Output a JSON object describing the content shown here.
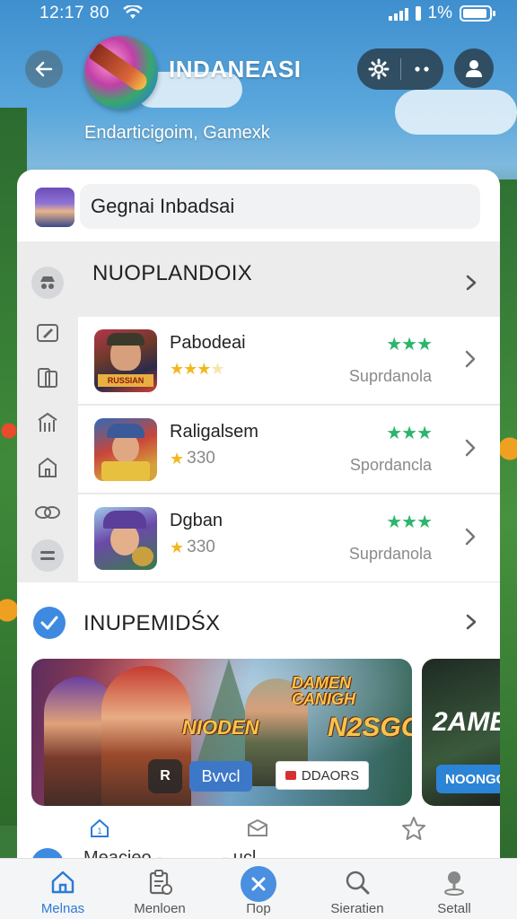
{
  "status_bar": {
    "time": "12:17 80",
    "battery": "1%"
  },
  "header": {
    "title": "INDANEASI",
    "subtitle": "Endarticigoim, Gamexk"
  },
  "search": {
    "value": "Gegnai Inbadsai"
  },
  "section_1": {
    "title": "NUOPLANDOIX",
    "games": [
      {
        "name": "Pabodeai",
        "rating_stars": 3,
        "meta": "",
        "category": "Suprdanola"
      },
      {
        "name": "Raligalsem",
        "rating_stars": 1,
        "meta": "330",
        "category": "Spordancla"
      },
      {
        "name": "Dgban",
        "rating_stars": 1,
        "meta": "330",
        "category": "Suprdanola"
      }
    ]
  },
  "section_2": {
    "title": "INUPEMIDŚX",
    "banner_main": {
      "text_1": "NIODEN",
      "text_2": "DAMEN CANIGH",
      "text_3": "N2SGO",
      "badge": "R",
      "button_1": "Bvvcl",
      "button_2": "DDAORS"
    },
    "banner_side": {
      "title": "2AME",
      "button": "NOONGG"
    }
  },
  "peek_row": {
    "text": "Meacieo -         ...-.ucl"
  },
  "bottom_nav": [
    {
      "label": "Melnas",
      "icon": "home-icon"
    },
    {
      "label": "Menloen",
      "icon": "clipboard-icon"
    },
    {
      "label": "Пор",
      "icon": "close-icon"
    },
    {
      "label": "Sieratien",
      "icon": "search-icon"
    },
    {
      "label": "Setall",
      "icon": "person-pin-icon"
    }
  ],
  "colors": {
    "accent": "#2d7bd6",
    "green_stars": "#2cb56b",
    "gold_stars": "#f2b81c"
  }
}
